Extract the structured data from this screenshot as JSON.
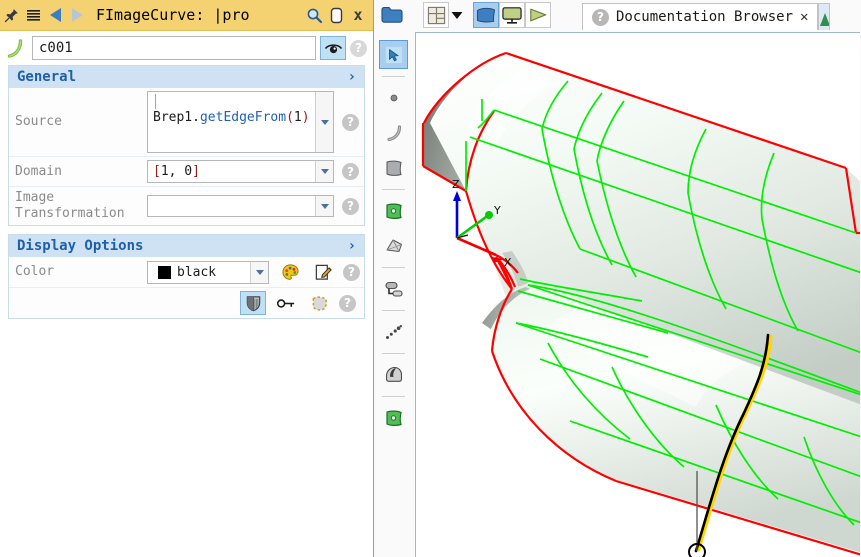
{
  "window": {
    "title": "FImageCurve: |pro",
    "pin_icon": "pin-icon",
    "menu_icon": "menu-icon",
    "back_icon": "back-arrow-icon",
    "forward_icon": "forward-arrow-icon",
    "search_icon": "search-icon",
    "copy_icon": "copy-icon",
    "close_label": "x",
    "titlebar_color": "#f5d271"
  },
  "name_row": {
    "curve_icon": "curve-icon",
    "value": "c001",
    "placeholder": "",
    "visibility_icon": "eye-icon",
    "help_label": "?"
  },
  "sections": [
    {
      "id": "general",
      "title": "General",
      "chevron": "›",
      "rows": [
        {
          "label": "Source",
          "value_tokens": [
            {
              "text": "Brep1.",
              "type": "obj"
            },
            {
              "text": "getEdgeFrom",
              "type": "fn"
            },
            {
              "text": "(",
              "type": "paren"
            },
            {
              "text": "1",
              "type": "obj"
            },
            {
              "text": ")",
              "type": "paren"
            }
          ],
          "value_plain": "Brep1.getEdgeFrom(1)",
          "help_label": "?"
        },
        {
          "label": "Domain",
          "value_tokens": [
            {
              "text": "[",
              "type": "brk"
            },
            {
              "text": "1, 0",
              "type": "obj"
            },
            {
              "text": "]",
              "type": "brk"
            }
          ],
          "value_plain": "[1, 0]",
          "help_label": "?"
        },
        {
          "label": "Image Transformation",
          "value_tokens": [],
          "value_plain": "",
          "help_label": "?"
        }
      ]
    },
    {
      "id": "display-options",
      "title": "Display Options",
      "chevron": "›",
      "rows": [
        {
          "label": "Color",
          "value_plain": "black",
          "swatch_color": "#000000",
          "palette_icon": "palette-icon",
          "edit_icon": "edit-pencil-icon",
          "help_label": "?"
        },
        {
          "label": "",
          "value_plain": "",
          "shade_icon": "shield-shading-icon",
          "key_icon": "key-icon",
          "selection_icon": "dashed-selection-icon",
          "help_label": "?"
        }
      ]
    }
  ],
  "toolbar": {
    "folder_icon": "folder-icon",
    "layout_icon": "layout-grid-icon",
    "layout_caret": "chevron-down-icon",
    "view_shape_icon": "shape-view-icon",
    "view_monitor_icon": "monitor-view-icon",
    "view_play_icon": "play-view-icon"
  },
  "tabs": [
    {
      "icon": "help-icon",
      "label": "Documentation Browser",
      "close": "✕",
      "active": true
    }
  ],
  "vertical_tools": [
    {
      "name": "select-arrow-tool",
      "selected": true,
      "sep_after": true
    },
    {
      "name": "point-tool",
      "selected": false,
      "sep_after": false
    },
    {
      "name": "curve-tool",
      "selected": false,
      "sep_after": false
    },
    {
      "name": "surface-tool",
      "selected": false,
      "sep_after": true
    },
    {
      "name": "green-surface-tool",
      "selected": false,
      "sep_after": false
    },
    {
      "name": "mesh-tool",
      "selected": false,
      "sep_after": true
    },
    {
      "name": "transform-tool",
      "selected": false,
      "sep_after": true
    },
    {
      "name": "dots-curve-tool",
      "selected": false,
      "sep_after": true
    },
    {
      "name": "shade-tool",
      "selected": false,
      "sep_after": true
    },
    {
      "name": "green-patch-tool",
      "selected": false,
      "sep_after": false
    }
  ],
  "viewport": {
    "axes": [
      {
        "label": "Z",
        "color": "#0000dd"
      },
      {
        "label": "Y",
        "color": "#00cc00"
      },
      {
        "label": "X",
        "color": "#ee0000"
      }
    ],
    "model_colors": {
      "edge": "#ff0000",
      "isocurve": "#00ee00",
      "surface_light": "#f4fbf6",
      "surface_mid": "#c8d4cc",
      "surface_dark": "#808880",
      "selected_curve": "#000000",
      "highlight_curve": "#ffd400",
      "background": "#ffffff"
    },
    "marker": "curve-start-point-marker"
  }
}
